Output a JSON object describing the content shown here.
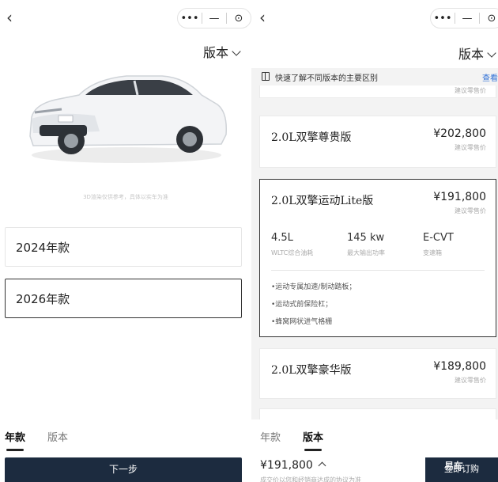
{
  "left": {
    "version_label": "版本",
    "car_note": "3D渲染仅供参考，具体以实车为准",
    "years": [
      "2024年款",
      "2026年款"
    ],
    "tabs": [
      {
        "label": "年款",
        "active": true
      },
      {
        "label": "版本",
        "active": false
      }
    ],
    "next_button": "下一步"
  },
  "capsule": {
    "menu": "•••",
    "minimize": "—",
    "close": "⊙"
  },
  "right": {
    "version_label": "版本",
    "info_text": "快速了解不同版本的主要区别",
    "info_link": "查看",
    "price_sub": "建议零售价",
    "versions": [
      {
        "name": "2.0L双擎尊贵版",
        "price": "¥202,800",
        "sub": "建议零售价"
      },
      {
        "name": "2.0L双擎运动Lite版",
        "price": "¥191,800",
        "sub": "建议零售价",
        "specs": [
          {
            "value": "4.5L",
            "label": "WLTC综合油耗"
          },
          {
            "value": "145 kw",
            "label": "最大输出功率"
          },
          {
            "value": "E-CVT",
            "label": "变速箱"
          }
        ],
        "features": [
          "•运动专属加速/制动踏板；",
          "•运动式前保险杠；",
          "•蜂窝网状进气格栅"
        ]
      },
      {
        "name": "2.0L双擎豪华版",
        "price": "¥189,800",
        "sub": "建议零售价"
      }
    ],
    "tabs": [
      {
        "label": "年款",
        "active": false
      },
      {
        "label": "版本",
        "active": true
      }
    ],
    "total_price": "¥191,800",
    "total_note": "成交价以您和经销商达成的协议为准",
    "order_button": "立即订购",
    "watermark": "易车"
  },
  "colors": {
    "primary_button": "#1c2b3f",
    "link": "#2e6fd6"
  }
}
